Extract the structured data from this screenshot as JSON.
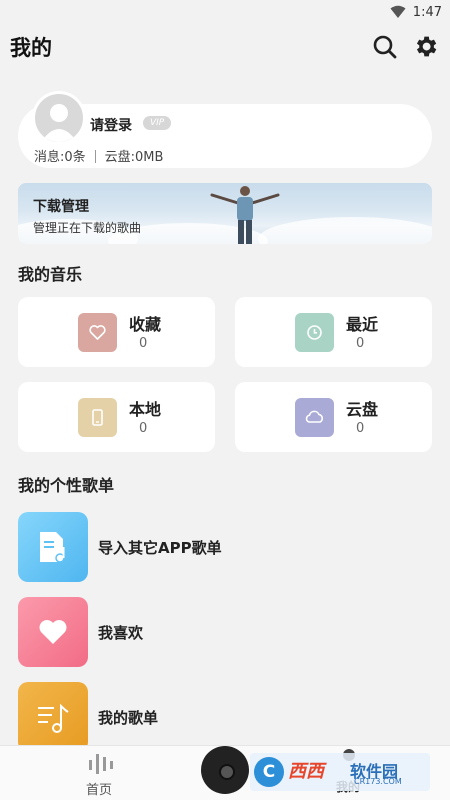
{
  "status_bar": {
    "time": "1:47",
    "icons": [
      "wifi-icon",
      "battery-icon"
    ]
  },
  "header": {
    "title": "我的",
    "search_icon": "search-icon",
    "settings_icon": "gear-icon"
  },
  "profile": {
    "login_label": "请登录",
    "vip_badge": "VIP",
    "messages": "消息:0条",
    "cloud_storage": "云盘:0MB"
  },
  "banner": {
    "title": "下载管理",
    "subtitle": "管理正在下载的歌曲"
  },
  "my_music": {
    "title": "我的音乐",
    "tiles": [
      {
        "label": "收藏",
        "count": "0",
        "icon": "heart-icon",
        "color": "#d9a7a0"
      },
      {
        "label": "最近",
        "count": "0",
        "icon": "clock-icon",
        "color": "#a8d3c5"
      },
      {
        "label": "本地",
        "count": "0",
        "icon": "phone-icon",
        "color": "#e4d1a7"
      },
      {
        "label": "云盘",
        "count": "0",
        "icon": "cloud-icon",
        "color": "#a9aad6"
      }
    ]
  },
  "playlists": {
    "title": "我的个性歌单",
    "items": [
      {
        "name": "导入其它APP歌单",
        "icon": "import-playlist-icon",
        "color": "#5ec2f4"
      },
      {
        "name": "我喜欢",
        "icon": "heart-icon",
        "color": "#f57d93"
      },
      {
        "name": "我的歌单",
        "icon": "music-list-icon",
        "color": "#e8a62f"
      }
    ]
  },
  "bottom_nav": {
    "home_label": "首页",
    "me_label": "我的"
  },
  "watermark": {
    "brand": "西西",
    "site": "软件园",
    "url": "CR173.COM",
    "logo_letter": "C"
  }
}
